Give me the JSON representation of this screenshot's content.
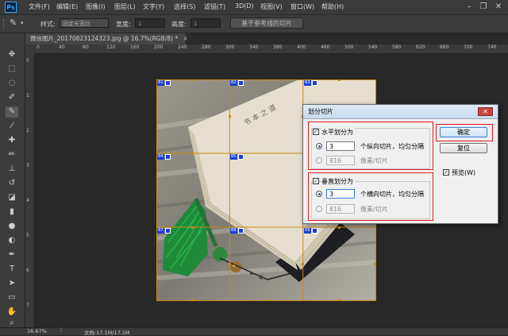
{
  "app": {
    "logo": "Ps"
  },
  "menu": {
    "items": [
      "文件(F)",
      "编辑(E)",
      "图像(I)",
      "图层(L)",
      "文字(Y)",
      "选择(S)",
      "滤镜(T)",
      "3D(D)",
      "视图(V)",
      "窗口(W)",
      "帮助(H)"
    ]
  },
  "window_controls": {
    "minimize": "–",
    "restore": "❐",
    "close": "✕"
  },
  "options_bar": {
    "style_label": "样式:",
    "style_value": "固定长宽比",
    "width_label": "宽度:",
    "width_value": "1",
    "height_label": "高度:",
    "height_value": "1",
    "guides_button": "基于参考线的切片"
  },
  "document_tab": {
    "title": "微信图片_20170823124323.jpg @ 16.7%(RGB/8) *",
    "close": "×"
  },
  "rulers": {
    "horizontal": [
      "0",
      "40",
      "80",
      "120",
      "160",
      "200",
      "240",
      "280",
      "300",
      "340",
      "380",
      "400",
      "460",
      "500",
      "540",
      "580",
      "620",
      "660",
      "700",
      "740"
    ],
    "vertical": [
      "0",
      "1",
      "2",
      "3",
      "4",
      "5",
      "6",
      "7"
    ]
  },
  "slices": [
    {
      "id": "01"
    },
    {
      "id": "02"
    },
    {
      "id": "03"
    },
    {
      "id": "04"
    },
    {
      "id": "05"
    },
    {
      "id": "06"
    },
    {
      "id": "07"
    },
    {
      "id": "08"
    },
    {
      "id": "09"
    }
  ],
  "status_bar": {
    "zoom": "16.67%",
    "doc_info": "文档:17.1M/17.1M"
  },
  "dialog": {
    "title": "划分切片",
    "close": "✕",
    "horizontal": {
      "checkbox_label": "水平划分为",
      "checked": true,
      "count_value": "3",
      "count_label": "个纵向切片，均匀分隔",
      "pixel_value": "816",
      "pixel_label": "像素/切片"
    },
    "vertical": {
      "checkbox_label": "垂直划分为",
      "checked": true,
      "count_value": "3",
      "count_label": "个横向切片，均匀分隔",
      "pixel_value": "816",
      "pixel_label": "像素/切片"
    },
    "ok_button": "确定",
    "reset_button": "复位",
    "preview_label": "预览(W)",
    "preview_checked": true
  },
  "colors": {
    "highlight": "#e3161c",
    "slice_line": "#b8860b",
    "slice_badge": "#1c3fd8",
    "ps_blue": "#31a8ff"
  }
}
